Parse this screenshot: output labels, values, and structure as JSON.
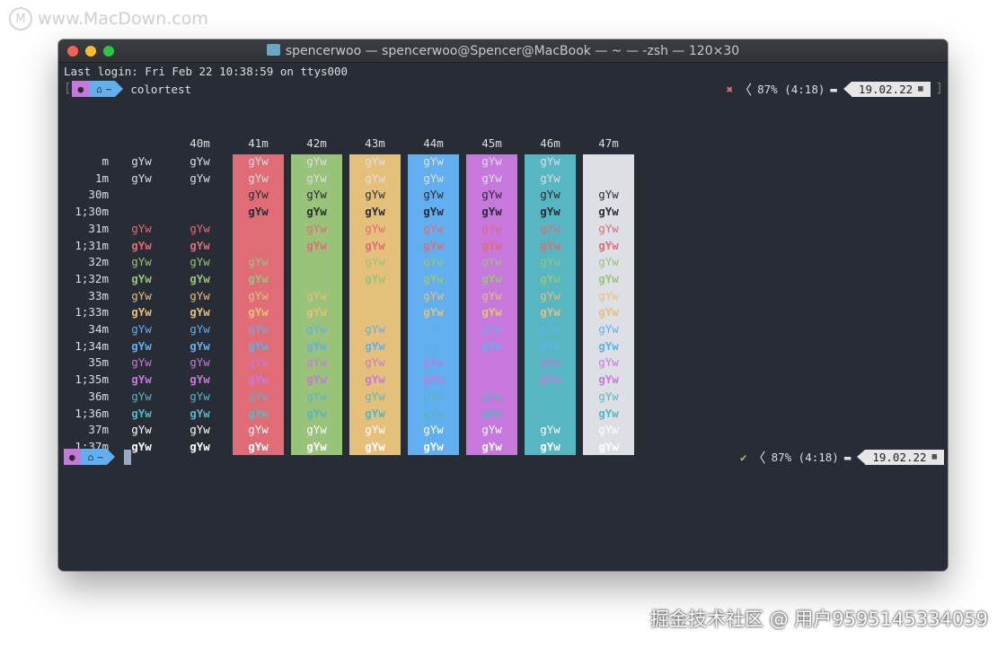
{
  "watermark_top": "www.MacDown.com",
  "watermark_bottom": "掘金技术社区 @ 用户9595145334059",
  "window": {
    "title": "spencerwoo — spencerwoo@Spencer@MacBook — ~ — -zsh — 120×30",
    "title_icon": "folder-icon"
  },
  "terminal": {
    "last_login": "Last login: Fri Feb 22 10:38:59 on ttys000",
    "prompt1": {
      "home": "~",
      "command": "colortest",
      "status": "✖",
      "battery": "87% (4:18)",
      "bat_icon": "▬",
      "date": "19.02.22",
      "calendar": "▦"
    },
    "prompt2": {
      "home": "~",
      "command": "",
      "status": "✔",
      "battery": "87% (4:18)",
      "bat_icon": "▬",
      "date": "19.02.22",
      "calendar": "▦"
    }
  },
  "colortest": {
    "sample": "gYw",
    "columns": [
      "40m",
      "41m",
      "42m",
      "43m",
      "44m",
      "45m",
      "46m",
      "47m"
    ],
    "column_backgrounds": [
      "#e06c75",
      "#98c379",
      "#e5c07b",
      "#61afef",
      "#c678dd",
      "#56b6c2",
      "#dcdfe4"
    ],
    "rows": [
      "m",
      "1m",
      "30m",
      "1;30m",
      "31m",
      "1;31m",
      "32m",
      "1;32m",
      "33m",
      "1;33m",
      "34m",
      "1;34m",
      "35m",
      "1;35m",
      "36m",
      "1;36m",
      "37m",
      "1;37m"
    ],
    "row_foregrounds": [
      "#dcdfe4",
      "#dcdfe4",
      "#282c34",
      "#282c34",
      "#e06c75",
      "#e06c75",
      "#98c379",
      "#98c379",
      "#e5c07b",
      "#e5c07b",
      "#61afef",
      "#61afef",
      "#c678dd",
      "#c678dd",
      "#56b6c2",
      "#56b6c2",
      "#ffffff",
      "#ffffff"
    ],
    "row_bold": [
      false,
      false,
      false,
      true,
      false,
      true,
      false,
      true,
      false,
      true,
      false,
      true,
      false,
      true,
      false,
      true,
      false,
      true
    ]
  }
}
